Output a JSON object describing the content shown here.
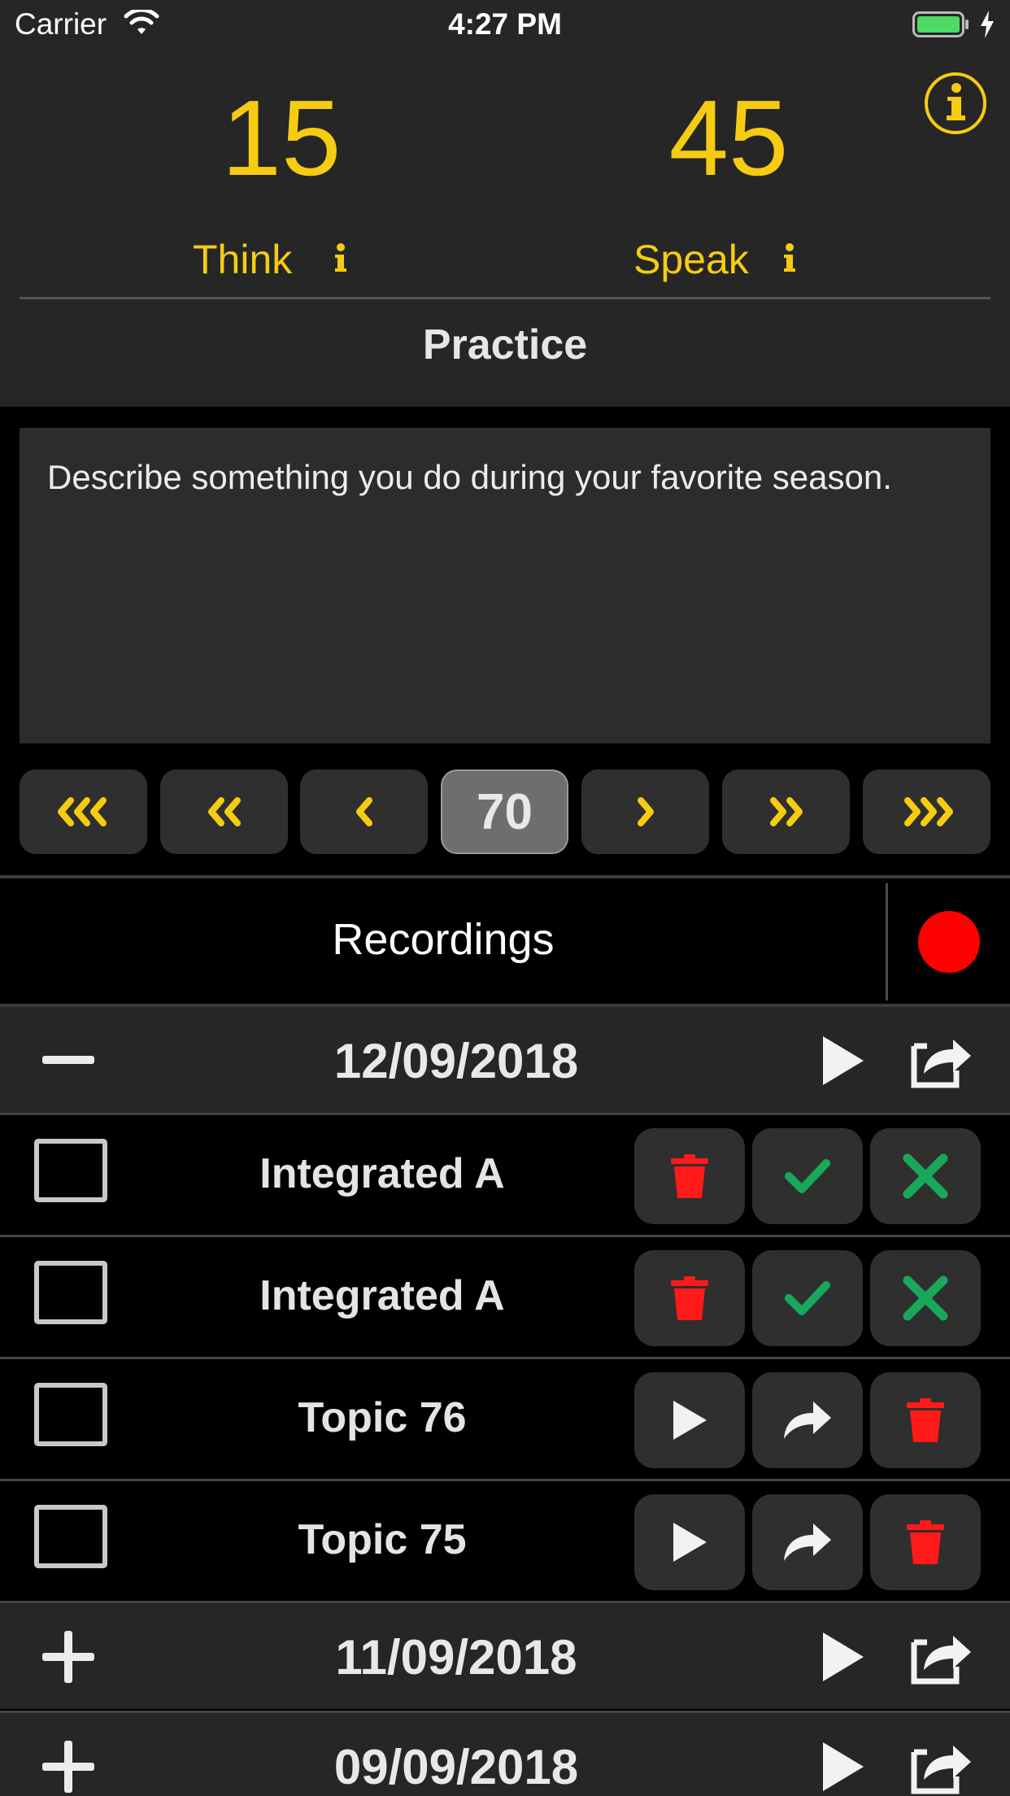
{
  "status_bar": {
    "carrier": "Carrier",
    "time": "4:27 PM"
  },
  "timers": {
    "think": {
      "value": "15",
      "label": "Think"
    },
    "speak": {
      "value": "45",
      "label": "Speak"
    }
  },
  "practice": {
    "title": "Practice",
    "prompt": "Describe something you do during your favorite season."
  },
  "navigator": {
    "current": "70",
    "buttons": [
      "first",
      "back-10",
      "previous",
      "current",
      "next",
      "forward-10",
      "last"
    ]
  },
  "recordings": {
    "title": "Recordings",
    "groups": [
      {
        "date": "12/09/2018",
        "expanded": true,
        "items": [
          {
            "label": "Integrated A",
            "actions": [
              "delete",
              "accept",
              "reject"
            ]
          },
          {
            "label": "Integrated A",
            "actions": [
              "delete",
              "accept",
              "reject"
            ]
          },
          {
            "label": "Topic 76",
            "actions": [
              "play",
              "share",
              "delete"
            ]
          },
          {
            "label": "Topic 75",
            "actions": [
              "play",
              "share",
              "delete"
            ]
          }
        ]
      },
      {
        "date": "11/09/2018",
        "expanded": false
      },
      {
        "date": "09/09/2018",
        "expanded": false
      }
    ]
  },
  "colors": {
    "accent": "#f6cc12",
    "record": "#ff0000",
    "accept": "#19a85a",
    "delete": "#ff1a1a",
    "panel": "#262626",
    "button": "#2f2f2f"
  }
}
